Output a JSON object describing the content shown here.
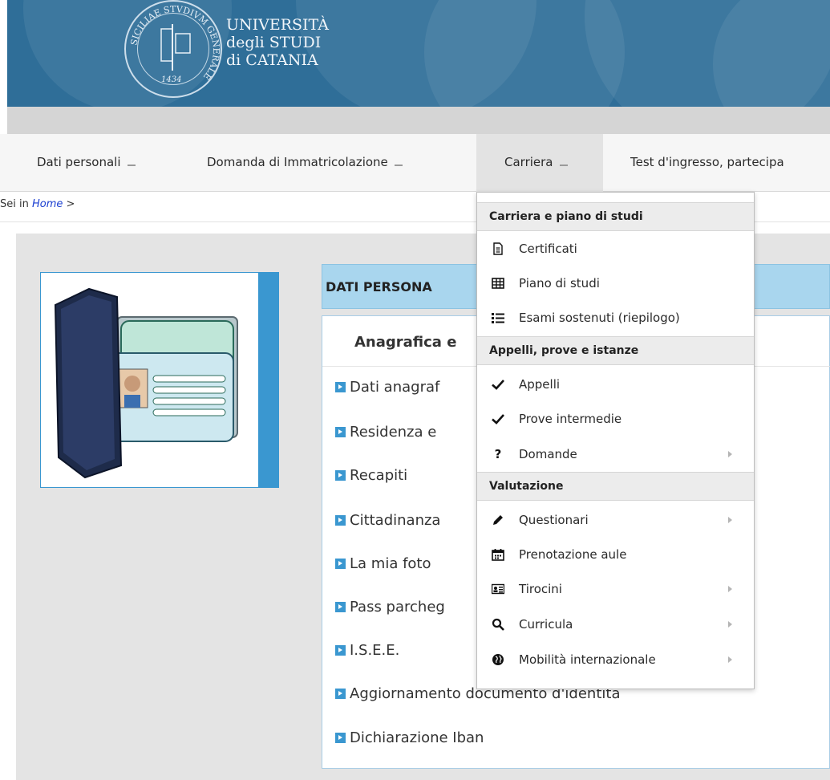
{
  "header": {
    "logo_lines": [
      "UNIVERSITÀ",
      "degli STUDI",
      "di CATANIA"
    ],
    "seal_text": "SICILIAE STVDIVM GENERALE",
    "seal_year": "1434",
    "bg_color": "#2f6e98"
  },
  "nav": {
    "items": [
      {
        "label": "Dati personali"
      },
      {
        "label": "Domanda di Immatricolazione"
      },
      {
        "label": "Carriera"
      },
      {
        "label": "Test d'ingresso, partecipa"
      }
    ],
    "active": "Carriera"
  },
  "breadcrumb": {
    "prefix": "Sei in",
    "home": "Home",
    "sep": ">"
  },
  "section": {
    "header": "DATI PERSONA",
    "title": "Anagrafica e",
    "links": [
      "Dati anagraf",
      "Residenza e",
      "Recapiti",
      "Cittadinanza",
      "La mia foto",
      "Pass parcheg",
      "I.S.E.E.",
      "Aggiornamento documento d'identità",
      "Dichiarazione Iban"
    ]
  },
  "dropdown": {
    "groups": [
      {
        "title": "Carriera e piano di studi",
        "items": [
          {
            "label": "Certificati",
            "icon": "document-icon",
            "submenu": false
          },
          {
            "label": "Piano di studi",
            "icon": "table-icon",
            "submenu": false
          },
          {
            "label": "Esami sostenuti (riepilogo)",
            "icon": "list-icon",
            "submenu": false
          }
        ]
      },
      {
        "title": "Appelli, prove e istanze",
        "items": [
          {
            "label": "Appelli",
            "icon": "check-icon",
            "submenu": false
          },
          {
            "label": "Prove intermedie",
            "icon": "check-icon",
            "submenu": false
          },
          {
            "label": "Domande",
            "icon": "question-icon",
            "submenu": true
          }
        ]
      },
      {
        "title": "Valutazione",
        "items": [
          {
            "label": "Questionari",
            "icon": "pencil-icon",
            "submenu": true
          },
          {
            "label": "Prenotazione aule",
            "icon": "calendar-icon",
            "submenu": false
          },
          {
            "label": "Tirocini",
            "icon": "id-card-icon",
            "submenu": true
          },
          {
            "label": "Curricula",
            "icon": "search-icon",
            "submenu": true
          },
          {
            "label": "Mobilità internazionale",
            "icon": "globe-icon",
            "submenu": true
          }
        ]
      }
    ]
  },
  "colors": {
    "accent": "#3a97d0",
    "section_header": "#a9d6ee",
    "link_blue": "#1b3fd1"
  }
}
